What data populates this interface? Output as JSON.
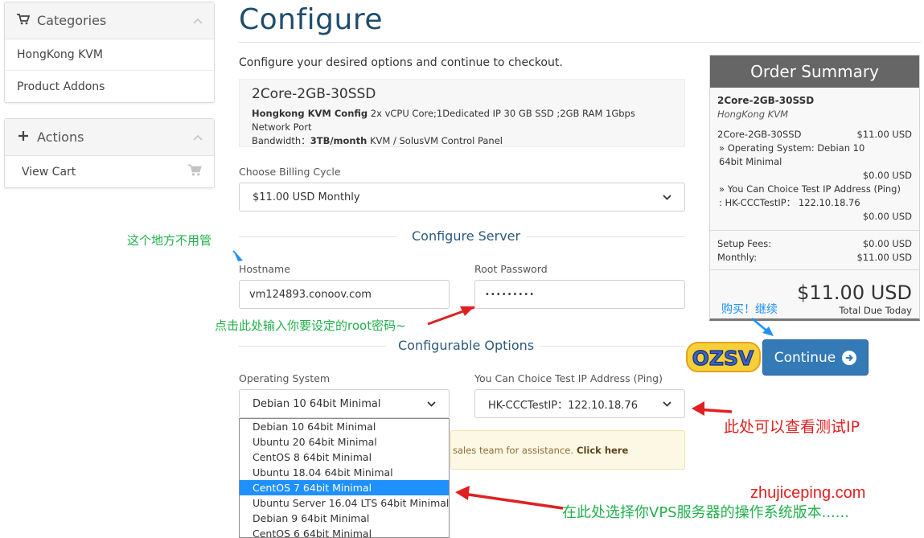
{
  "sidebar": {
    "categories": {
      "title": "Categories",
      "items": [
        "HongKong KVM",
        "Product Addons"
      ]
    },
    "actions": {
      "title": "Actions",
      "items": [
        "View Cart"
      ]
    }
  },
  "main": {
    "title": "Configure",
    "subtitle": "Configure your desired options and continue to checkout.",
    "product": {
      "name": "2Core-2GB-30SSD",
      "config_label": "Hongkong KVM Config",
      "config_text": " 2x vCPU Core;1Dedicated IP 30 GB SSD ;2GB RAM 1Gbps Network Port",
      "bandwidth_label": "Bandwidth：",
      "bandwidth_value": "3TB/month",
      "bandwidth_rest": " KVM / SolusVM Control Panel"
    },
    "billing": {
      "label": "Choose Billing Cycle",
      "value": "$11.00 USD Monthly"
    },
    "configure_server": {
      "heading": "Configure Server",
      "hostname_label": "Hostname",
      "hostname_value": "vm124893.conoov.com",
      "password_label": "Root Password",
      "password_value": "•••••••••"
    },
    "configurable_options": {
      "heading": "Configurable Options",
      "os_label": "Operating System",
      "os_value": "Debian 10 64bit Minimal",
      "ip_label": "You Can Choice Test IP Address (Ping)",
      "ip_value": "HK-CCCTestIP：122.10.18.76",
      "os_options": [
        "Debian 10 64bit Minimal",
        "Ubuntu 20 64bit Minimal",
        "CentOS 8 64bit Minimal",
        "Ubuntu 18.04 64bit Minimal",
        "CentOS 7 64bit Minimal",
        "Ubuntu Server 16.04 LTS 64bit Minimal",
        "Debian 9 64bit Minimal",
        "CentOS 6 64bit Minimal"
      ],
      "os_highlighted_index": 4
    },
    "notice": {
      "text": "sales team for assistance.",
      "link": "Click here"
    }
  },
  "summary": {
    "title": "Order Summary",
    "product": "2Core-2GB-30SSD",
    "group": "HongKong KVM",
    "line_item": "2Core-2GB-30SSD",
    "line_item_price": "$11.00 USD",
    "os_line": "» Operating System: Debian 10 64bit Minimal",
    "os_price": "$0.00 USD",
    "ip_line": "» You Can Choice Test IP Address (Ping) : HK-CCCTestIP： 122.10.18.76",
    "ip_price": "$0.00 USD",
    "setup_label": "Setup Fees:",
    "setup_value": "$0.00 USD",
    "monthly_label": "Monthly:",
    "monthly_value": "$11.00 USD",
    "total": "$11.00 USD",
    "total_label": "Total Due Today"
  },
  "continue_label": "Continue",
  "logo_text": "OZSV",
  "annotations": {
    "ignore_here": "这个地方不用管",
    "root_password": "点击此处输入你要设定的root密码~",
    "buy_continue": "购买！继续",
    "test_ip": "此处可以查看测试IP",
    "watermark": "zhujiceping.com",
    "choose_os": "在此处选择你VPS服务器的操作系统版本......"
  },
  "colors": {
    "title_blue": "#1f4e6b",
    "button_blue": "#337ab7",
    "highlight_blue": "#1e90ff",
    "annotation_green": "#22b14c",
    "annotation_red": "#e02020",
    "summary_header": "#666666",
    "notice_bg": "#fcf8e3"
  },
  "icons": {
    "categories": "shopping-cart-icon",
    "actions": "plus-icon",
    "collapse": "chevron-up-icon",
    "view_cart": "shopping-cart-icon",
    "continue": "arrow-circle-right-icon",
    "select": "chevron-down-icon"
  }
}
